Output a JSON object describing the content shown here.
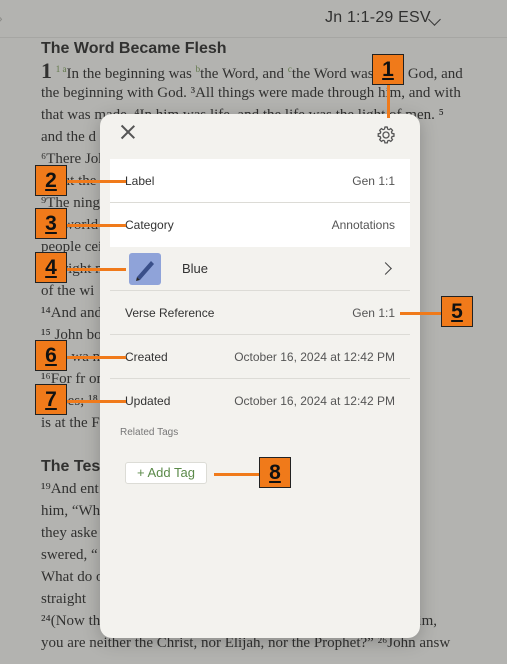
{
  "topbar": {
    "reference": "Jn 1:1-29 ESV"
  },
  "bible": {
    "heading1": "The Word Became Flesh",
    "chapter": "1",
    "lines": [
      "the beginning with God. ³All things were made through him, and with",
      "that was made. ⁴In him was life, and the life was the light of men. ⁵",
      "and the d",
      "⁶There                                              John. ⁷He ca",
      "about the",
      "⁹The                                                ning into the w",
      "the world                                           t know him. ¹",
      "people                                              ceive him, ⁵wh",
      "the right                                           not of blood",
      "of the wi",
      "¹⁴And                                              and we ha",
      "  ¹⁵                                                John bore w",
      "This wa                                             nks before m",
      "¹⁶For fr                                            on grace. ¹⁷",
      "Moses; ¹⁸                                           o one has eve",
      "is at the F"
    ],
    "heading2": "The Test",
    "lines2": [
      "¹⁹And                                               ent priests an",
      "him, “Wh                                            y, but confes",
      "they aske                                           I am not.” “A",
      "swered, “                                           need to give",
      "What do                                             oice of one c",
      "straight",
      "²⁴(Now they had been sent from the Pharisees.) ²⁵They asked him,",
      "you are neither the Christ, nor Elijah, nor the Prophet?” ²⁶John answ"
    ],
    "verse1_start": "In the beginning was ",
    "verse1_mid": "the Word, and ",
    "verse1_end": "the Word was with God, and"
  },
  "popover": {
    "label": {
      "title": "Label",
      "value": "Gen 1:1"
    },
    "category": {
      "title": "Category",
      "value": "Annotations"
    },
    "color": {
      "name": "Blue"
    },
    "verse_reference": {
      "title": "Verse Reference",
      "value": "Gen 1:1"
    },
    "created": {
      "title": "Created",
      "value": "October 16, 2024 at 12:42 PM"
    },
    "updated": {
      "title": "Updated",
      "value": "October 16, 2024 at 12:42 PM"
    },
    "related_tags_title": "Related Tags",
    "add_tag_label": "+ Add Tag"
  },
  "callouts": [
    "1",
    "2",
    "3",
    "4",
    "5",
    "6",
    "7",
    "8"
  ],
  "colors": {
    "accent_orange": "#f07a1a",
    "highlight_blue": "#8fa3d9",
    "tag_green": "#5b8a49"
  },
  "icons": [
    "close-icon",
    "gear-icon",
    "pen-icon",
    "chevron-right-icon",
    "chevron-down-icon"
  ]
}
